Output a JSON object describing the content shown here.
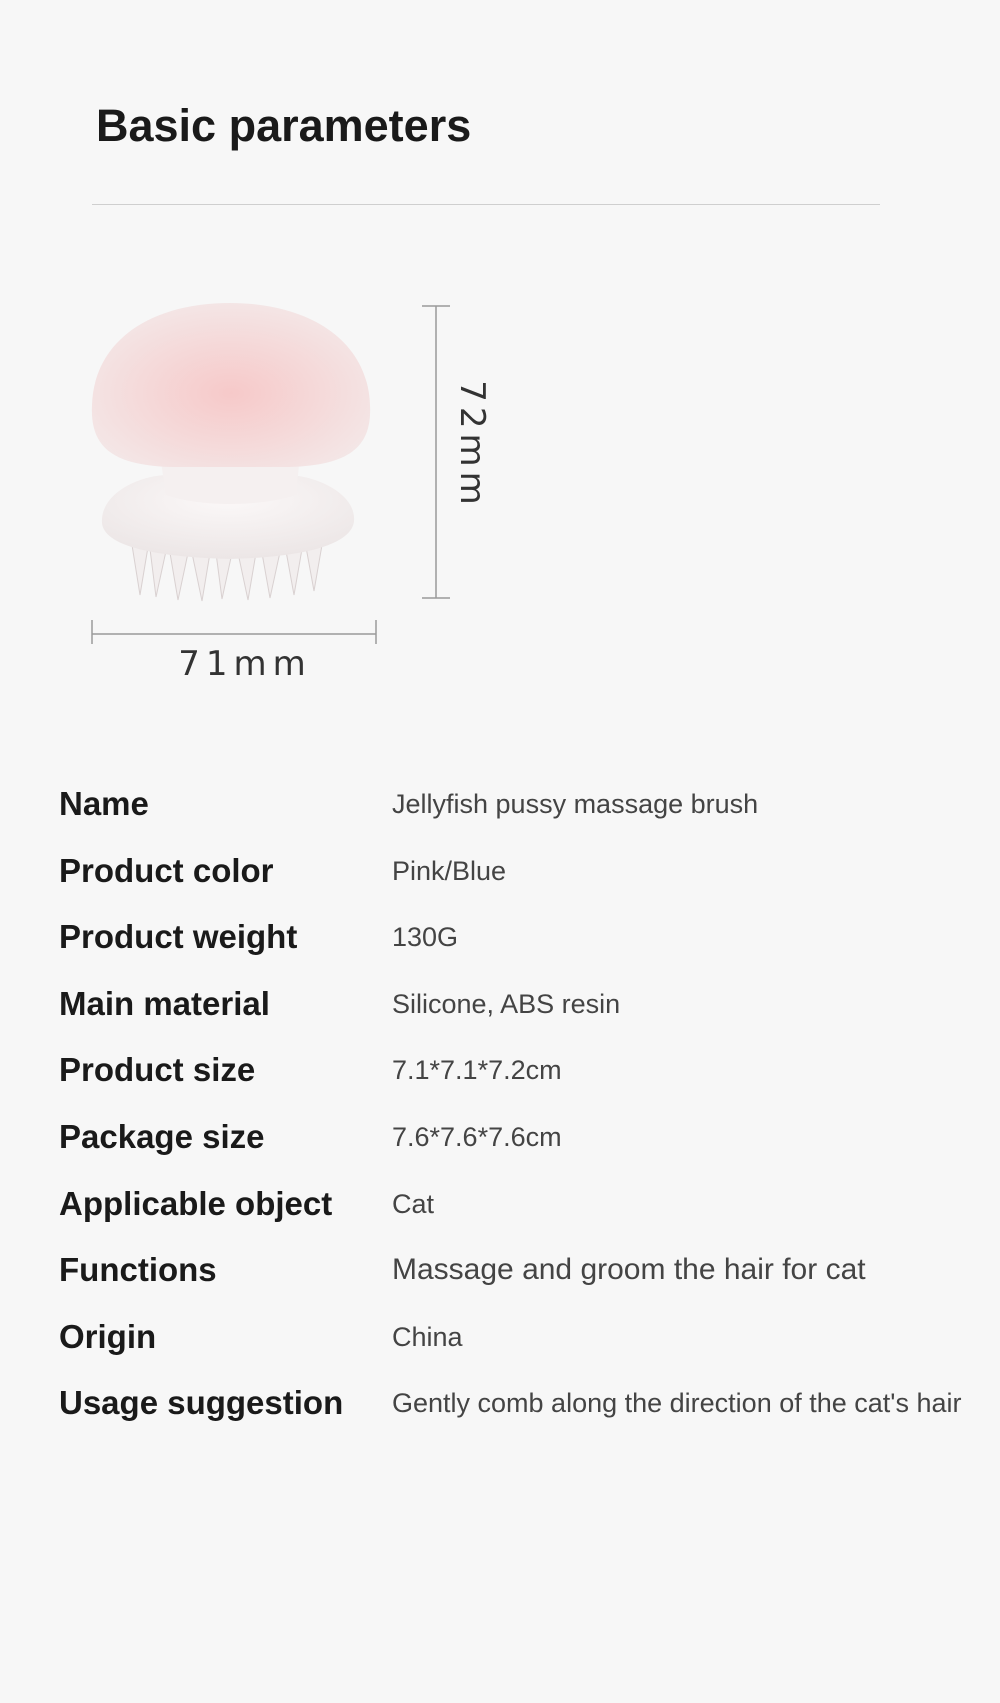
{
  "header": {
    "title": "Basic parameters"
  },
  "dimensions": {
    "height_label": "72mm",
    "width_label": "71mm"
  },
  "parameters": [
    {
      "label": "Name",
      "value": "Jellyfish pussy massage brush"
    },
    {
      "label": "Product color",
      "value": "Pink/Blue"
    },
    {
      "label": "Product weight",
      "value": "130G"
    },
    {
      "label": "Main material",
      "value": "Silicone, ABS resin"
    },
    {
      "label": "Product size",
      "value": "7.1*7.1*7.2cm"
    },
    {
      "label": "Package size",
      "value": "7.6*7.6*7.6cm"
    },
    {
      "label": "Applicable object",
      "value": "Cat"
    },
    {
      "label": "Functions",
      "value": "Massage and groom the hair for cat"
    },
    {
      "label": "Origin",
      "value": "China"
    },
    {
      "label": "Usage suggestion",
      "value": "Gently comb along the direction of the cat's hair"
    }
  ],
  "colors": {
    "background": "#f7f7f7",
    "heading": "#1a1a1a",
    "value_text": "#444444",
    "divider": "#cfcfcf",
    "product_cap": "#f4dada",
    "product_body": "#f6f3f3"
  }
}
